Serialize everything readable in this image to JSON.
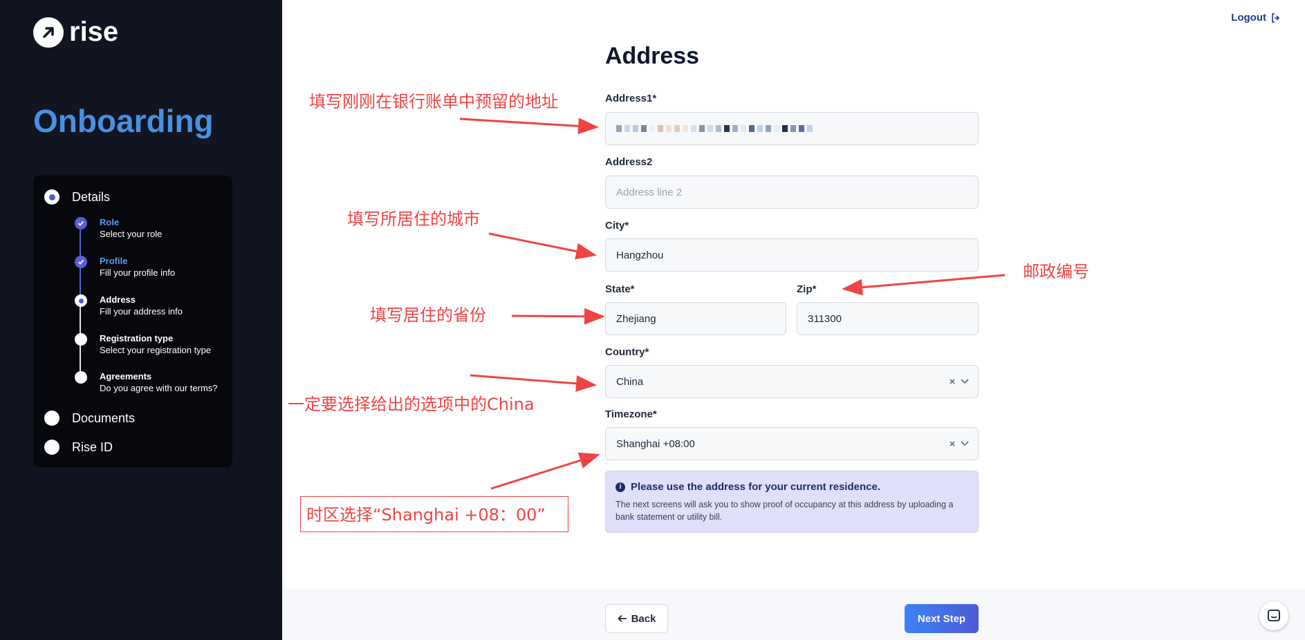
{
  "brand": {
    "logo_text": "rise"
  },
  "sidebar": {
    "title": "Onboarding",
    "main_steps": [
      {
        "label": "Details"
      },
      {
        "label": "Documents"
      },
      {
        "label": "Rise ID"
      }
    ],
    "sub_steps": [
      {
        "title": "Role",
        "desc": "Select your role"
      },
      {
        "title": "Profile",
        "desc": "Fill your profile info"
      },
      {
        "title": "Address",
        "desc": "Fill your address info"
      },
      {
        "title": "Registration type",
        "desc": "Select your registration type"
      },
      {
        "title": "Agreements",
        "desc": "Do you agree with our terms?"
      }
    ]
  },
  "header": {
    "logout_label": "Logout"
  },
  "form": {
    "title": "Address",
    "address1_label": "Address1*",
    "address2_label": "Address2",
    "address2_placeholder": "Address line 2",
    "city_label": "City*",
    "city_value": "Hangzhou",
    "state_label": "State*",
    "state_value": "Zhejiang",
    "zip_label": "Zip*",
    "zip_value": "311300",
    "country_label": "Country*",
    "country_value": "China",
    "timezone_label": "Timezone*",
    "timezone_value": "Shanghai +08:00"
  },
  "notice": {
    "title": "Please use the address for your current residence.",
    "body": "The next screens will ask you to show proof of occupancy at this address by uploading a bank statement or utility bill."
  },
  "footer": {
    "back_label": "Back",
    "next_label": "Next Step"
  },
  "annotations": {
    "address": "填写刚刚在银行账单中预留的地址",
    "city": "填写所居住的城市",
    "state": "填写居住的省份",
    "zip": "邮政编号",
    "country": "一定要选择给出的选项中的China",
    "timezone": "时区选择“Shanghai +08：00”"
  },
  "colors": {
    "sidebar_bg": "#101521",
    "accent": "#4f5bd5",
    "title_blue": "#4a90e2",
    "annotation_red": "#ef4444"
  }
}
